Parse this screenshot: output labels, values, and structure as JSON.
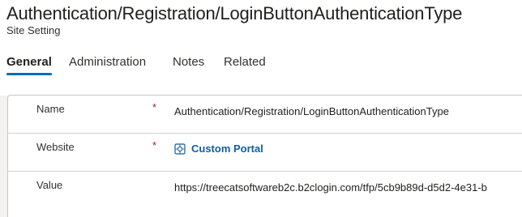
{
  "header": {
    "title": "Authentication/Registration/LoginButtonAuthenticationType",
    "subtitle": "Site Setting"
  },
  "tabs": [
    {
      "label": "General",
      "active": true
    },
    {
      "label": "Administration",
      "active": false
    },
    {
      "label": "Notes",
      "active": false
    },
    {
      "label": "Related",
      "active": false
    }
  ],
  "form": {
    "fields": [
      {
        "label": "Name",
        "required_marker": "*",
        "value": "Authentication/Registration/LoginButtonAuthenticationType"
      },
      {
        "label": "Website",
        "required_marker": "*",
        "value": "Custom Portal",
        "icon": "website-lookup-icon"
      },
      {
        "label": "Value",
        "value": "https://treecatsoftwareb2c.b2clogin.com/tfp/5cb9b89d-d5d2-4e31-b"
      }
    ]
  },
  "colors": {
    "accent": "#0f6cbd",
    "link": "#115ea3",
    "required": "#a4262c"
  }
}
